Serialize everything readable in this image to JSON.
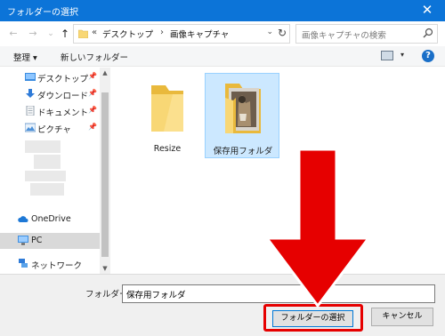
{
  "window": {
    "title": "フォルダーの選択",
    "close_glyph": "✕"
  },
  "navigation": {
    "back_glyph": "←",
    "forward_glyph": "→",
    "recent_glyph": "⌄",
    "up_glyph": "↑"
  },
  "address": {
    "overflow_glyph": "«",
    "separator_glyph": "›",
    "crumbs": [
      "デスクトップ",
      "画像キャプチャ"
    ],
    "dropdown_glyph": "⌄",
    "refresh_glyph": "↻"
  },
  "search": {
    "placeholder": "画像キャプチャの検索"
  },
  "toolbar": {
    "organize": "整理 ▾",
    "new_folder": "新しいフォルダー",
    "view_dropdown_glyph": "▾",
    "help_glyph": "?"
  },
  "sidebar": {
    "pin_glyph": "📌",
    "quick_access": [
      "デスクトップ",
      "ダウンロード",
      "ドキュメント",
      "ピクチャ"
    ],
    "onedrive": "OneDrive",
    "pc": "PC",
    "network": "ネットワーク",
    "scroll_up_glyph": "▲",
    "scroll_down_glyph": "▼"
  },
  "files": [
    {
      "name": "Resize",
      "selected": false
    },
    {
      "name": "保存用フォルダ",
      "selected": true
    }
  ],
  "footer": {
    "folder_label": "フォルダー:",
    "folder_value": "保存用フォルダ",
    "select_button": "フォルダーの選択",
    "cancel_button": "キャンセル"
  },
  "colors": {
    "titlebar": "#0c74d8",
    "selection": "#cce8ff",
    "annotation_red": "#e60000",
    "folder_yellow": "#f8d775"
  }
}
